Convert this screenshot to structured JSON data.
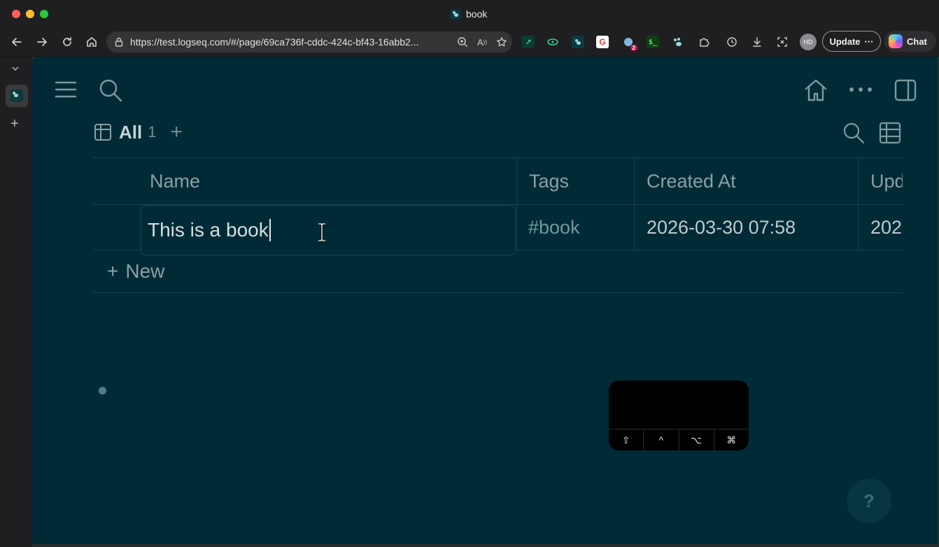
{
  "browser": {
    "tab_title": "book",
    "url": "https://test.logseq.com/#/page/69ca736f-cddc-424c-bf43-16abb2...",
    "avatar_initials": "HD",
    "update_label": "Update",
    "update_more": "···",
    "chat_label": "Chat",
    "extension_badge": "2"
  },
  "app": {
    "view": {
      "label": "All",
      "count": "1",
      "add": "+"
    },
    "table": {
      "columns": [
        "Name",
        "Tags",
        "Created At",
        "Upd"
      ],
      "rows": [
        {
          "name": "This is a book",
          "tags": "#book",
          "created_at": "2026-03-30 07:58",
          "updated_at": "202"
        }
      ],
      "new_label": "New"
    },
    "keyboard_keys": [
      "⇧",
      "^",
      "⌥",
      "⌘"
    ],
    "help_label": "?"
  },
  "colors": {
    "app_background": "#002b36",
    "browser_chrome": "#1f1f21",
    "accent_link": "#6d99a1"
  }
}
